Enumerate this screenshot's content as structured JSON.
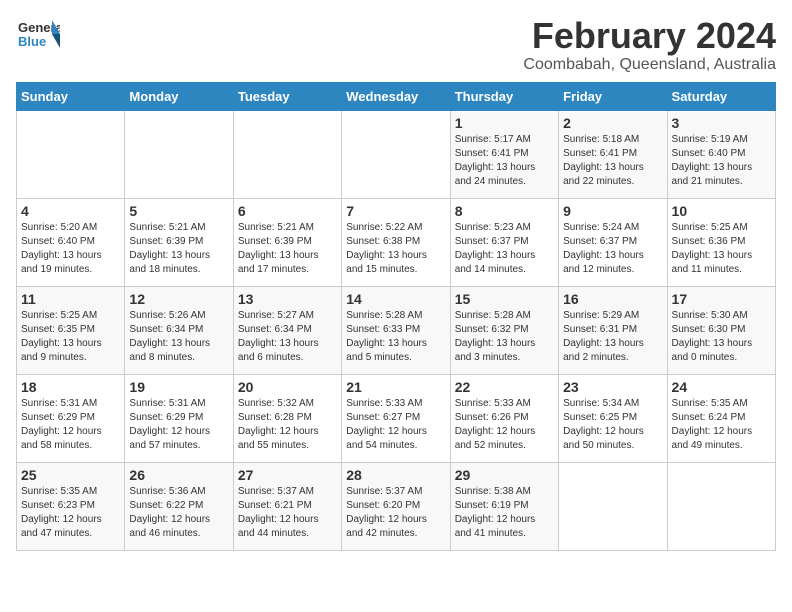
{
  "header": {
    "logo_general": "General",
    "logo_blue": "Blue",
    "title": "February 2024",
    "location": "Coombabah, Queensland, Australia"
  },
  "days_of_week": [
    "Sunday",
    "Monday",
    "Tuesday",
    "Wednesday",
    "Thursday",
    "Friday",
    "Saturday"
  ],
  "weeks": [
    [
      {
        "day": "",
        "info": ""
      },
      {
        "day": "",
        "info": ""
      },
      {
        "day": "",
        "info": ""
      },
      {
        "day": "",
        "info": ""
      },
      {
        "day": "1",
        "info": "Sunrise: 5:17 AM\nSunset: 6:41 PM\nDaylight: 13 hours\nand 24 minutes."
      },
      {
        "day": "2",
        "info": "Sunrise: 5:18 AM\nSunset: 6:41 PM\nDaylight: 13 hours\nand 22 minutes."
      },
      {
        "day": "3",
        "info": "Sunrise: 5:19 AM\nSunset: 6:40 PM\nDaylight: 13 hours\nand 21 minutes."
      }
    ],
    [
      {
        "day": "4",
        "info": "Sunrise: 5:20 AM\nSunset: 6:40 PM\nDaylight: 13 hours\nand 19 minutes."
      },
      {
        "day": "5",
        "info": "Sunrise: 5:21 AM\nSunset: 6:39 PM\nDaylight: 13 hours\nand 18 minutes."
      },
      {
        "day": "6",
        "info": "Sunrise: 5:21 AM\nSunset: 6:39 PM\nDaylight: 13 hours\nand 17 minutes."
      },
      {
        "day": "7",
        "info": "Sunrise: 5:22 AM\nSunset: 6:38 PM\nDaylight: 13 hours\nand 15 minutes."
      },
      {
        "day": "8",
        "info": "Sunrise: 5:23 AM\nSunset: 6:37 PM\nDaylight: 13 hours\nand 14 minutes."
      },
      {
        "day": "9",
        "info": "Sunrise: 5:24 AM\nSunset: 6:37 PM\nDaylight: 13 hours\nand 12 minutes."
      },
      {
        "day": "10",
        "info": "Sunrise: 5:25 AM\nSunset: 6:36 PM\nDaylight: 13 hours\nand 11 minutes."
      }
    ],
    [
      {
        "day": "11",
        "info": "Sunrise: 5:25 AM\nSunset: 6:35 PM\nDaylight: 13 hours\nand 9 minutes."
      },
      {
        "day": "12",
        "info": "Sunrise: 5:26 AM\nSunset: 6:34 PM\nDaylight: 13 hours\nand 8 minutes."
      },
      {
        "day": "13",
        "info": "Sunrise: 5:27 AM\nSunset: 6:34 PM\nDaylight: 13 hours\nand 6 minutes."
      },
      {
        "day": "14",
        "info": "Sunrise: 5:28 AM\nSunset: 6:33 PM\nDaylight: 13 hours\nand 5 minutes."
      },
      {
        "day": "15",
        "info": "Sunrise: 5:28 AM\nSunset: 6:32 PM\nDaylight: 13 hours\nand 3 minutes."
      },
      {
        "day": "16",
        "info": "Sunrise: 5:29 AM\nSunset: 6:31 PM\nDaylight: 13 hours\nand 2 minutes."
      },
      {
        "day": "17",
        "info": "Sunrise: 5:30 AM\nSunset: 6:30 PM\nDaylight: 13 hours\nand 0 minutes."
      }
    ],
    [
      {
        "day": "18",
        "info": "Sunrise: 5:31 AM\nSunset: 6:29 PM\nDaylight: 12 hours\nand 58 minutes."
      },
      {
        "day": "19",
        "info": "Sunrise: 5:31 AM\nSunset: 6:29 PM\nDaylight: 12 hours\nand 57 minutes."
      },
      {
        "day": "20",
        "info": "Sunrise: 5:32 AM\nSunset: 6:28 PM\nDaylight: 12 hours\nand 55 minutes."
      },
      {
        "day": "21",
        "info": "Sunrise: 5:33 AM\nSunset: 6:27 PM\nDaylight: 12 hours\nand 54 minutes."
      },
      {
        "day": "22",
        "info": "Sunrise: 5:33 AM\nSunset: 6:26 PM\nDaylight: 12 hours\nand 52 minutes."
      },
      {
        "day": "23",
        "info": "Sunrise: 5:34 AM\nSunset: 6:25 PM\nDaylight: 12 hours\nand 50 minutes."
      },
      {
        "day": "24",
        "info": "Sunrise: 5:35 AM\nSunset: 6:24 PM\nDaylight: 12 hours\nand 49 minutes."
      }
    ],
    [
      {
        "day": "25",
        "info": "Sunrise: 5:35 AM\nSunset: 6:23 PM\nDaylight: 12 hours\nand 47 minutes."
      },
      {
        "day": "26",
        "info": "Sunrise: 5:36 AM\nSunset: 6:22 PM\nDaylight: 12 hours\nand 46 minutes."
      },
      {
        "day": "27",
        "info": "Sunrise: 5:37 AM\nSunset: 6:21 PM\nDaylight: 12 hours\nand 44 minutes."
      },
      {
        "day": "28",
        "info": "Sunrise: 5:37 AM\nSunset: 6:20 PM\nDaylight: 12 hours\nand 42 minutes."
      },
      {
        "day": "29",
        "info": "Sunrise: 5:38 AM\nSunset: 6:19 PM\nDaylight: 12 hours\nand 41 minutes."
      },
      {
        "day": "",
        "info": ""
      },
      {
        "day": "",
        "info": ""
      }
    ]
  ]
}
